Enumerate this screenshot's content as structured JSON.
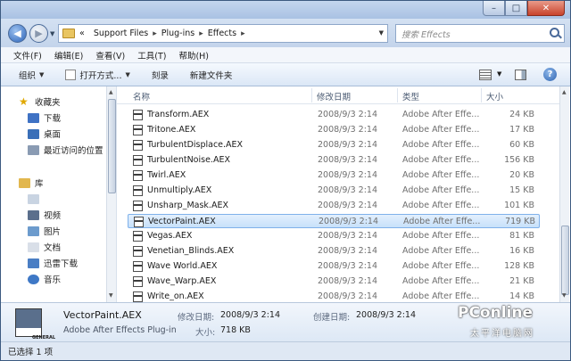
{
  "address": {
    "prefix": "«",
    "crumbs": [
      "Support Files",
      "Plug-ins",
      "Effects"
    ]
  },
  "search": {
    "placeholder": "搜索 Effects"
  },
  "menu": [
    "文件(F)",
    "编辑(E)",
    "查看(V)",
    "工具(T)",
    "帮助(H)"
  ],
  "commands": {
    "organize": "组织",
    "open_with": "打开方式...",
    "burn": "刻录",
    "new_folder": "新建文件夹"
  },
  "nav": {
    "favorites": "收藏夹",
    "downloads": "下载",
    "desktop": "桌面",
    "recent": "最近访问的位置",
    "libraries": "库",
    "video": "视频",
    "pictures": "图片",
    "documents": "文档",
    "thunder": "迅雷下载",
    "music": "音乐"
  },
  "columns": {
    "name": "名称",
    "date": "修改日期",
    "type": "类型",
    "size": "大小"
  },
  "files": [
    {
      "name": "Transform.AEX",
      "date": "2008/9/3 2:14",
      "type": "Adobe After Effe...",
      "size": "24 KB"
    },
    {
      "name": "Tritone.AEX",
      "date": "2008/9/3 2:14",
      "type": "Adobe After Effe...",
      "size": "17 KB"
    },
    {
      "name": "TurbulentDisplace.AEX",
      "date": "2008/9/3 2:14",
      "type": "Adobe After Effe...",
      "size": "60 KB"
    },
    {
      "name": "TurbulentNoise.AEX",
      "date": "2008/9/3 2:14",
      "type": "Adobe After Effe...",
      "size": "156 KB"
    },
    {
      "name": "Twirl.AEX",
      "date": "2008/9/3 2:14",
      "type": "Adobe After Effe...",
      "size": "20 KB"
    },
    {
      "name": "Unmultiply.AEX",
      "date": "2008/9/3 2:14",
      "type": "Adobe After Effe...",
      "size": "15 KB"
    },
    {
      "name": "Unsharp_Mask.AEX",
      "date": "2008/9/3 2:14",
      "type": "Adobe After Effe...",
      "size": "101 KB"
    },
    {
      "name": "VectorPaint.AEX",
      "date": "2008/9/3 2:14",
      "type": "Adobe After Effe...",
      "size": "719 KB"
    },
    {
      "name": "Vegas.AEX",
      "date": "2008/9/3 2:14",
      "type": "Adobe After Effe...",
      "size": "81 KB"
    },
    {
      "name": "Venetian_Blinds.AEX",
      "date": "2008/9/3 2:14",
      "type": "Adobe After Effe...",
      "size": "16 KB"
    },
    {
      "name": "Wave World.AEX",
      "date": "2008/9/3 2:14",
      "type": "Adobe After Effe...",
      "size": "128 KB"
    },
    {
      "name": "Wave_Warp.AEX",
      "date": "2008/9/3 2:14",
      "type": "Adobe After Effe...",
      "size": "21 KB"
    },
    {
      "name": "Write_on.AEX",
      "date": "2008/9/3 2:14",
      "type": "Adobe After Effe...",
      "size": "14 KB"
    }
  ],
  "selected_index": 7,
  "details": {
    "icon_label": "GENERAL",
    "name": "VectorPaint.AEX",
    "type": "Adobe After Effects Plug-in",
    "modified_label": "修改日期:",
    "modified": "2008/9/3 2:14",
    "created_label": "创建日期:",
    "created": "2008/9/3 2:14",
    "size_label": "大小:",
    "size": "718 KB"
  },
  "status": "已选择 1 项",
  "watermark": {
    "logo": "PConline",
    "sub": "太平洋电脑网"
  },
  "colors": {
    "selection": "#c7e0fa",
    "chrome": "#dbe6f4",
    "accent": "#2a62b8"
  }
}
